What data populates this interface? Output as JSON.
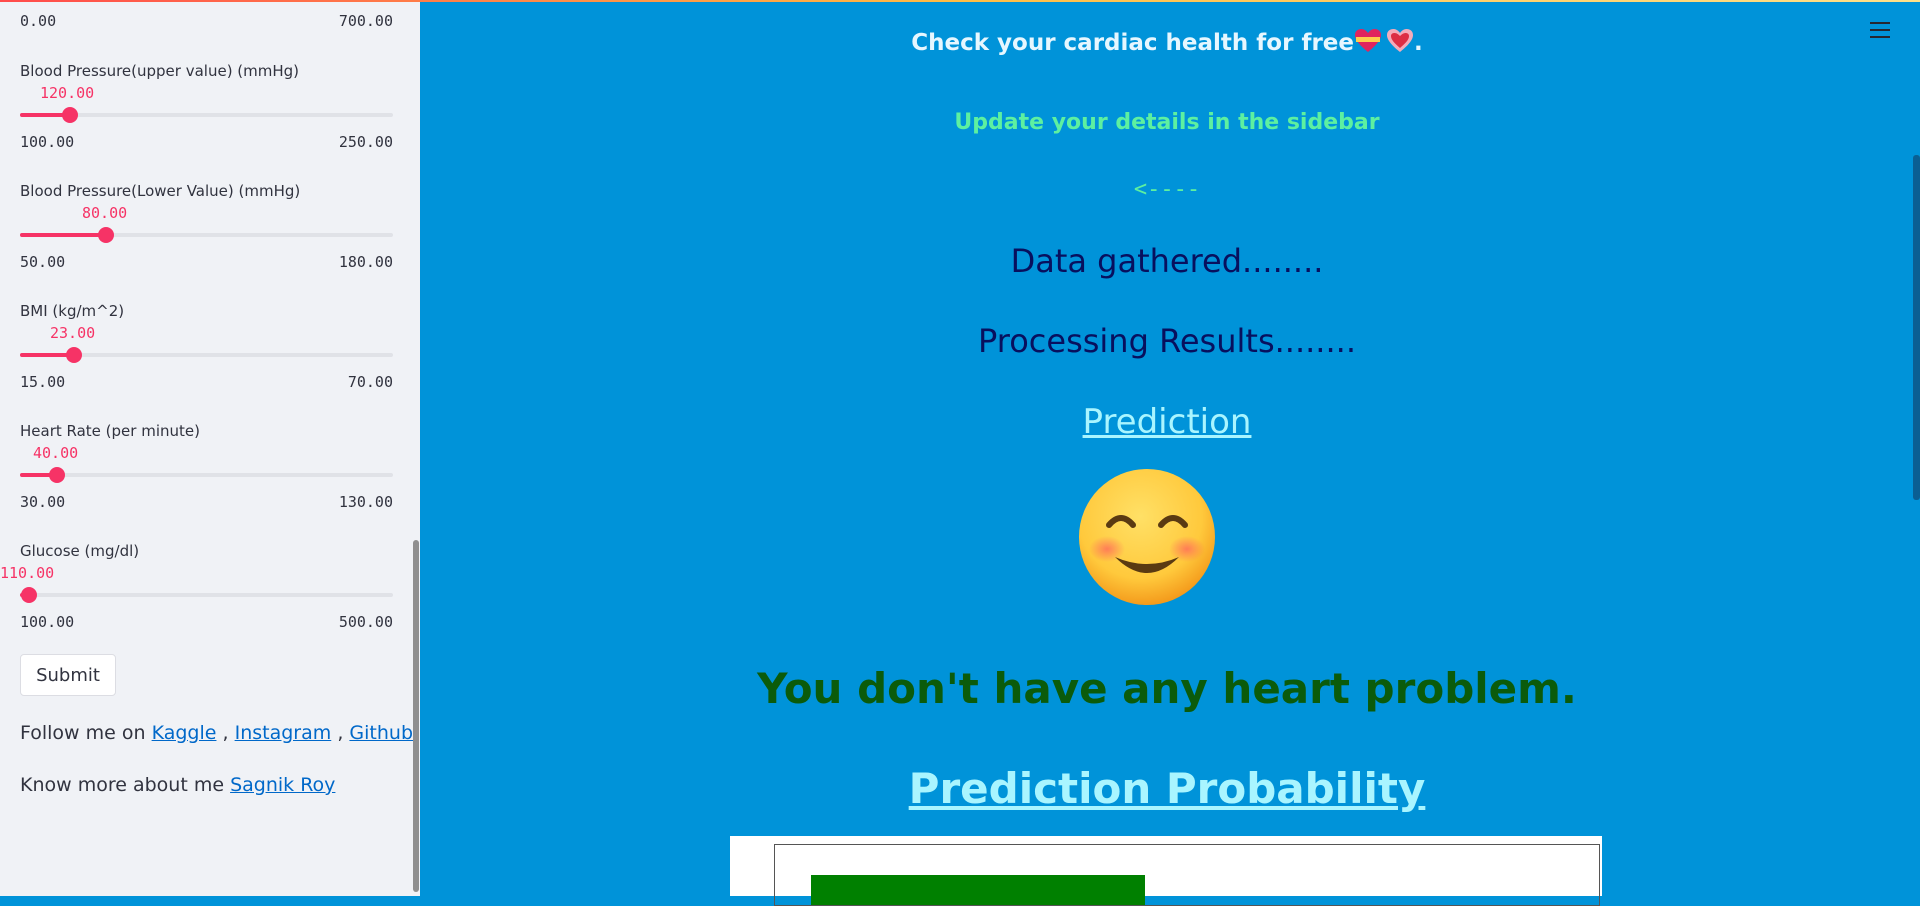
{
  "sidebar": {
    "top_slider": {
      "min": "0.00",
      "max": "700.00"
    },
    "sliders": [
      {
        "label": "Blood Pressure(upper value) (mmHg)",
        "value": "120.00",
        "min": "100.00",
        "max": "250.00"
      },
      {
        "label": "Blood Pressure(Lower Value) (mmHg)",
        "value": "80.00",
        "min": "50.00",
        "max": "180.00"
      },
      {
        "label": "BMI (kg/m^2)",
        "value": "23.00",
        "min": "15.00",
        "max": "70.00"
      },
      {
        "label": "Heart Rate (per minute)",
        "value": "40.00",
        "min": "30.00",
        "max": "130.00"
      },
      {
        "label": "Glucose (mg/dl)",
        "value": "110.00",
        "min": "100.00",
        "max": "500.00"
      }
    ],
    "submit_label": "Submit",
    "follow_text": "Follow me on",
    "links": {
      "kaggle": "Kaggle",
      "instagram": "Instagram",
      "github": "Github"
    },
    "sep1": ",",
    "sep2": ",",
    "know_text": "Know more about me",
    "author_link": "Sagnik Roy"
  },
  "main": {
    "title": "Check your cardiac health for free",
    "title_suffix": ".",
    "update_text": "Update your details in the sidebar",
    "arrow_text": "<----",
    "gathered_text": "Data gathered........",
    "processing_text": "Processing Results........",
    "prediction_heading": "Prediction",
    "result_text": "You don't have any heart problem.",
    "probability_heading": "Prediction Probability"
  },
  "colors": {
    "main_bg": "#0093d9",
    "sidebar_bg": "#f0f2f6",
    "accent": "#f63366",
    "title": "#e6f7ff",
    "update": "#5df0a0",
    "status": "#08105e",
    "heading_link": "#a9f5ff",
    "result": "#0b5b0b",
    "bar": "#008000"
  }
}
